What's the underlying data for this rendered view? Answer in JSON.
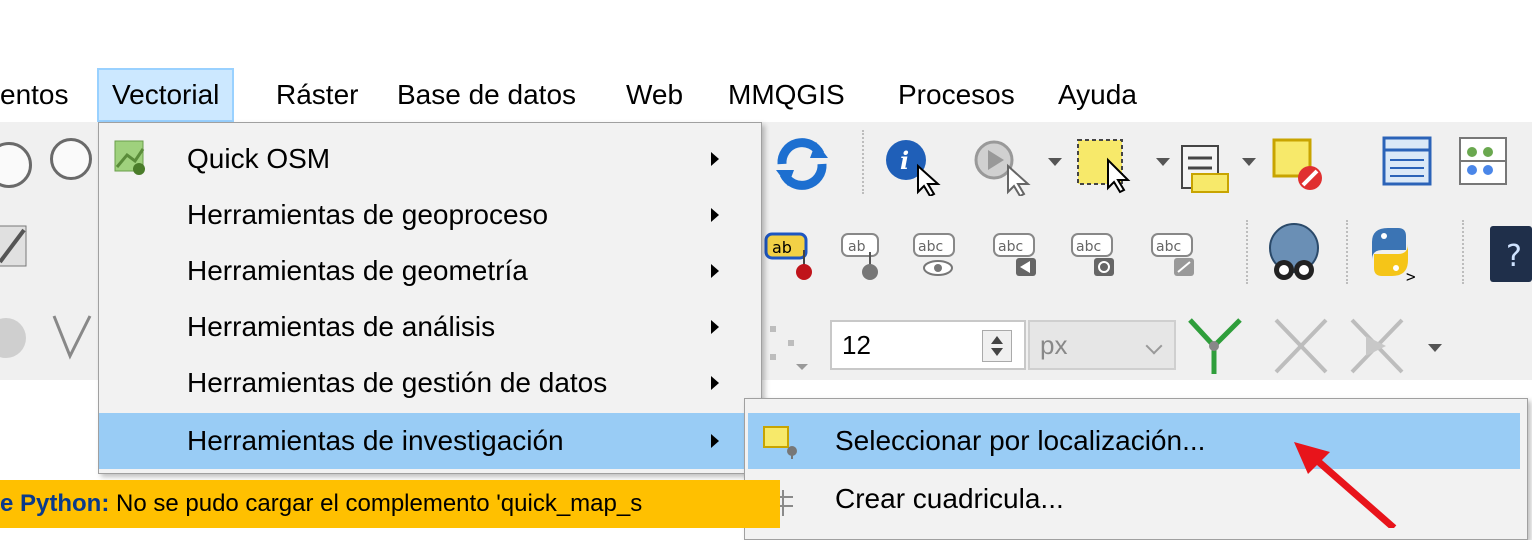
{
  "menubar": {
    "items": [
      {
        "label": "entos"
      },
      {
        "label": "Vectorial"
      },
      {
        "label": "Ráster"
      },
      {
        "label": "Base de datos"
      },
      {
        "label": "Web"
      },
      {
        "label": "MMQGIS"
      },
      {
        "label": "Procesos"
      },
      {
        "label": "Ayuda"
      }
    ]
  },
  "vectorial_menu": {
    "items": [
      {
        "label": "Quick OSM",
        "icon": "quick-osm-icon",
        "has_submenu": true
      },
      {
        "label": "Herramientas de geoproceso",
        "has_submenu": true
      },
      {
        "label": "Herramientas de geometría",
        "has_submenu": true
      },
      {
        "label": "Herramientas de análisis",
        "has_submenu": true
      },
      {
        "label": "Herramientas de gestión de datos",
        "has_submenu": true
      },
      {
        "label": "Herramientas de investigación",
        "has_submenu": true,
        "highlighted": true
      }
    ]
  },
  "submenu": {
    "items": [
      {
        "label": "Seleccionar por localización...",
        "icon": "select-by-location-icon",
        "highlighted": true
      },
      {
        "label": "Crear cuadricula...",
        "icon": "grid-icon"
      }
    ]
  },
  "toolbar": {
    "size_value": "12",
    "unit_value": "px"
  },
  "message_bar": {
    "prefix": "e Python:",
    "text": " No se pudo cargar el complemento 'quick_map_s"
  },
  "colors": {
    "menu_highlight": "#99ccf5",
    "message_bar": "#ffc000",
    "annotation_arrow": "#e8141b"
  }
}
